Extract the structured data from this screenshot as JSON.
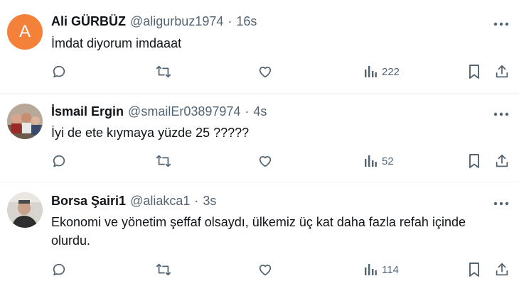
{
  "tweets": [
    {
      "name": "Ali GÜRBÜZ",
      "handle": "@aligurbuz1974",
      "separator": "·",
      "time": "16s",
      "avatar_letter": "A",
      "text": "İmdat diyorum imdaaat",
      "views": "222"
    },
    {
      "name": "İsmail Ergin",
      "handle": "@smailEr03897974",
      "separator": "·",
      "time": "4s",
      "text": "İyi de ete kıymaya yüzde 25 ?????",
      "views": "52"
    },
    {
      "name": "Borsa Şairi1",
      "handle": "@aliakca1",
      "separator": "·",
      "time": "3s",
      "text": "Ekonomi ve yönetim şeffaf olsaydı, ülkemiz üç kat daha fazla refah içinde olurdu.",
      "views": "114"
    }
  ],
  "colors": {
    "text_primary": "#0f1419",
    "text_secondary": "#536471",
    "avatar_orange": "#f4813a",
    "divider": "#eff3f4"
  },
  "icons": [
    "reply-icon",
    "retweet-icon",
    "like-icon",
    "views-icon",
    "bookmark-icon",
    "share-icon",
    "more-icon"
  ]
}
